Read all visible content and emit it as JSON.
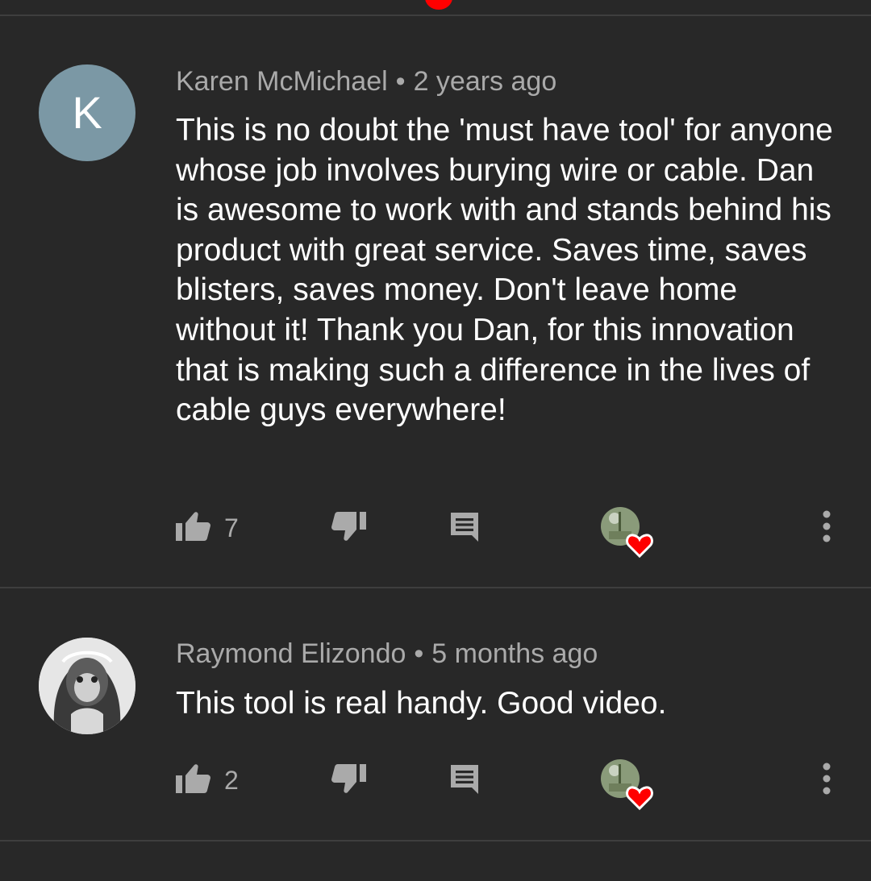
{
  "comments": [
    {
      "avatar_letter": "K",
      "author": "Karen McMichael",
      "separator": "•",
      "time": "2 years ago",
      "text": "This is no doubt the 'must have tool' for anyone whose job involves burying wire or cable.  Dan is awesome to work with and stands behind his product with great service.  Saves time, saves blisters, saves money.  Don't leave home without it!  Thank you Dan, for this innovation that is making such a difference in the lives of cable guys everywhere!",
      "likes": "7"
    },
    {
      "avatar_letter": "",
      "author": "Raymond Elizondo",
      "separator": "•",
      "time": "5 months ago",
      "text": "This tool is real handy.  Good video.",
      "likes": "2"
    }
  ],
  "icons": {
    "like": "thumb-up-icon",
    "dislike": "thumb-down-icon",
    "reply": "reply-comment-icon",
    "heart": "creator-heart-icon",
    "more": "more-vert-icon"
  },
  "colors": {
    "background": "#282828",
    "text": "#ffffff",
    "secondary_text": "#aaaaaa",
    "avatar_k": "#7b98a5",
    "heart": "#ff0000",
    "accent_red": "#ff0000"
  }
}
